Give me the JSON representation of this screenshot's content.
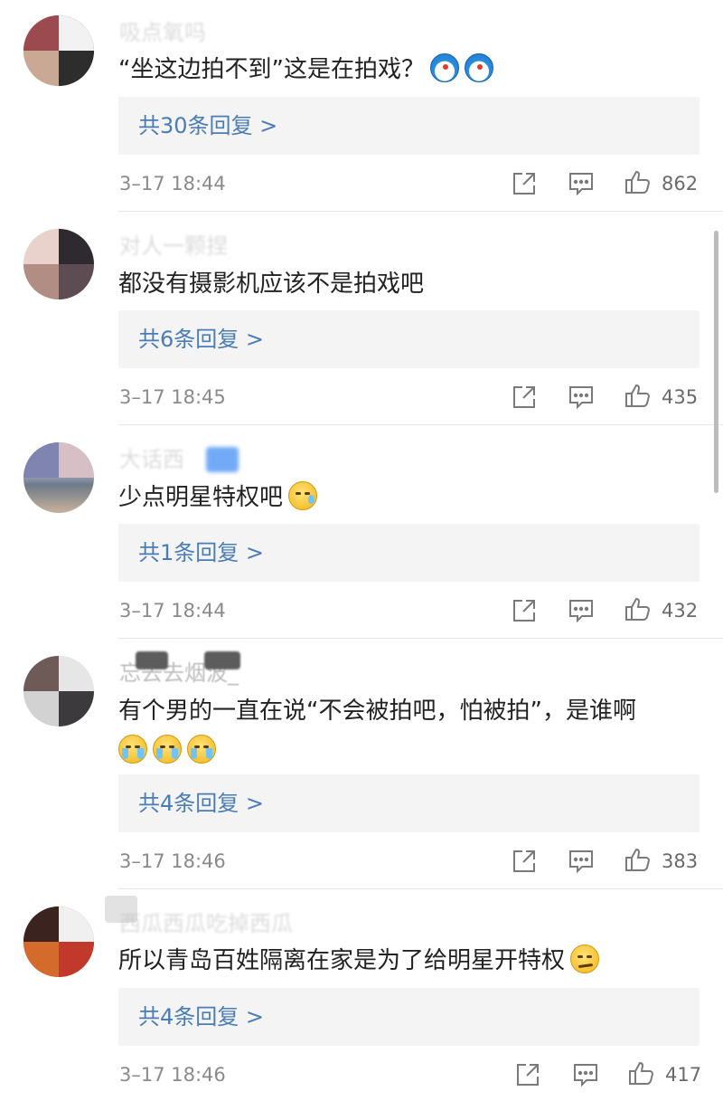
{
  "comments": [
    {
      "username": "吸点氧吗",
      "text": "“坐这边拍不到”这是在拍戏？",
      "emojis": [
        "doraemon-emoji",
        "doraemon-emoji"
      ],
      "reply_label": "共30条回复 >",
      "timestamp": "3–17 18:44",
      "likes": "862"
    },
    {
      "username": "对人一颗捏",
      "text": "都没有摄影机应该不是拍戏吧",
      "emojis": [],
      "reply_label": "共6条回复 >",
      "timestamp": "3–17 18:45",
      "likes": "435"
    },
    {
      "username": "大话西",
      "text": "少点明星特权吧",
      "emojis": [
        "sweat-emoji"
      ],
      "reply_label": "共1条回复 >",
      "timestamp": "3–17 18:44",
      "likes": "432"
    },
    {
      "username": "忘去去烟波_",
      "text": "有个男的一直在说“不会被拍吧，怕被拍”，是谁啊",
      "emojis": [
        "tears-of-joy-emoji",
        "tears-of-joy-emoji",
        "tears-of-joy-emoji"
      ],
      "reply_label": "共4条回复 >",
      "timestamp": "3–17 18:46",
      "likes": "383"
    },
    {
      "username": "西瓜西瓜吃掉西瓜",
      "text": "所以青岛百姓隔离在家是为了给明星开特权",
      "emojis": [
        "smirk-emoji"
      ],
      "reply_label": "共4条回复 >",
      "timestamp": "3–17 18:46",
      "likes": "417"
    }
  ],
  "icons": {
    "share": "share-icon",
    "comment": "comment-icon",
    "like": "thumbs-up-icon"
  },
  "colors": {
    "reply_link": "#4a7cb5",
    "reply_bg": "#f4f4f4",
    "meta_text": "#8a8a8a",
    "body_text": "#222222"
  }
}
